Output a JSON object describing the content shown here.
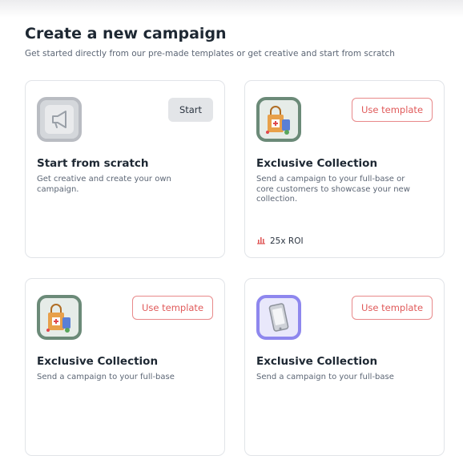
{
  "header": {
    "title": "Create a new campaign",
    "subtitle": "Get started directly from our pre-made templates or get creative and start from scratch"
  },
  "cards": [
    {
      "title": "Start from scratch",
      "description": "Get creative and create your own campaign.",
      "button": "Start",
      "icon": "megaphone-icon"
    },
    {
      "title": "Exclusive Collection",
      "description": "Send a campaign to your full-base or core customers to showcase your new collection.",
      "button": "Use template",
      "icon": "shopping-bag-icon",
      "stat": "25x ROI",
      "stat_icon": "bar-chart-icon"
    },
    {
      "title": "Exclusive Collection",
      "description": "Send a campaign to your full-base",
      "button": "Use template",
      "icon": "shopping-bag-icon"
    },
    {
      "title": "Exclusive Collection",
      "description": "Send a campaign to your full-base",
      "button": "Use template",
      "icon": "phone-icon"
    }
  ],
  "colors": {
    "accent": "#e05a5a",
    "accent_border": "#e8898a",
    "card_border": "#e1e4e8",
    "start_button_bg": "#e3e5e8"
  }
}
